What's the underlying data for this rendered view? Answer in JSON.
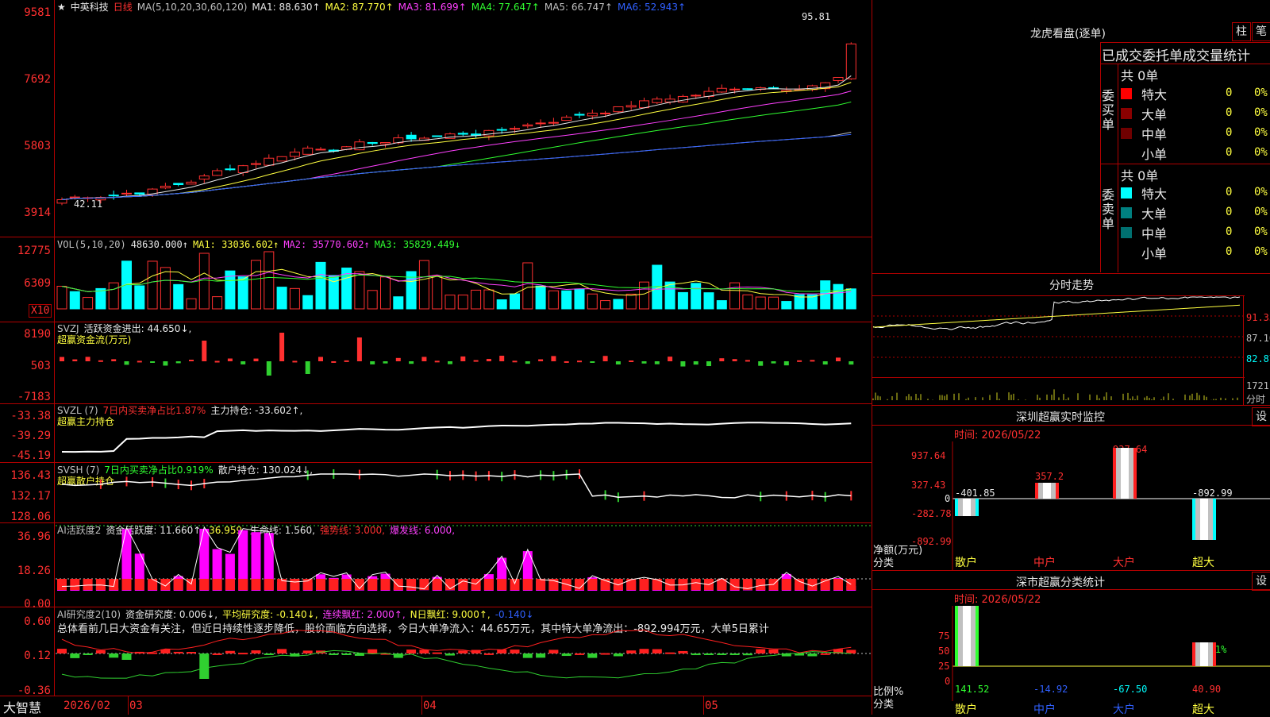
{
  "stock": {
    "name": "中英科技",
    "period": "日线",
    "star": "★"
  },
  "price_header": {
    "ma_label": "MA(5,10,20,30,60,120)",
    "ma1": "MA1: 88.630↑",
    "ma2": "MA2: 87.770↑",
    "ma3": "MA3: 81.699↑",
    "ma4": "MA4: 77.647↑",
    "ma5": "MA5: 66.747↑",
    "ma6": "MA6: 52.943↑",
    "high_label": "95.81",
    "low_label": "42.11"
  },
  "price_axis": [
    "9581",
    "7692",
    "5803",
    "3914"
  ],
  "vol_header": {
    "label": "VOL(5,10,20)",
    "value": "48630.000↑",
    "ma1": "MA1: 33036.602↑",
    "ma2": "MA2: 35770.602↑",
    "ma3": "MA3: 35829.449↓"
  },
  "vol_axis": [
    "12775",
    "6309"
  ],
  "vol_unit": "X10",
  "svzj_header": {
    "label": "SVZJ",
    "text": "活跃资金进出: 44.650↓,",
    "sub": "超赢资金流(万元)"
  },
  "svzj_axis": [
    "8190",
    "503",
    "-7183"
  ],
  "svzl_header": {
    "label": "SVZL (7)",
    "text1": "7日内买卖净占比1.87%",
    "text2": "主力持仓: -33.602↑,",
    "sub": "超赢主力持仓"
  },
  "svzl_axis": [
    "-33.38",
    "-39.29",
    "-45.19"
  ],
  "svsh_header": {
    "label": "SVSH (7)",
    "text1": "7日内买卖净占比0.919%",
    "text2": "散户持仓: 130.024↓,",
    "sub": "超赢散户持仓"
  },
  "svsh_axis": [
    "136.43",
    "132.17",
    "128.06"
  ],
  "ai_header": {
    "label": "AI活跃度2",
    "t1": "资金活跃度: 11.660↑,",
    "t2": "36.959,",
    "t3": "生命线: 1.560,",
    "t4": "强势线: 3.000,",
    "t5": "爆发线: 6.000,"
  },
  "ai_axis": [
    "36.96",
    "18.26",
    "0.00"
  ],
  "air_header": {
    "label": "AI研究度2(10)",
    "t1": "资金研究度: 0.006↓,",
    "t2": "平均研究度: -0.140↓,",
    "t3": "连续飘红: 2.000↑,",
    "t4": "N日飘红: 9.000↑,",
    "t5": "-0.140↓"
  },
  "air_text": "总体看前几日大资金有关注，但近日持续性逐步降低，股价面临方向选择，今日大单净流入：44.65万元，其中特大单净流出：-892.994万元，大单5日累计",
  "air_axis": [
    "0.60",
    "0.12",
    "-0.36"
  ],
  "time_axis": {
    "brand": "大智慧",
    "labels": [
      "2026/02",
      "03",
      "04",
      "05"
    ]
  },
  "right": {
    "lh_title": "龙虎看盘(逐单)",
    "btn_zhu": "柱",
    "btn_bi": "笔",
    "table_title": "已成交委托单成交量统计",
    "buy_label": "委买单",
    "sell_label": "委卖单",
    "buy_total": "共 0单",
    "sell_total": "共 0单",
    "buy_rows": [
      {
        "name": "特大",
        "v": "0",
        "p": "0%"
      },
      {
        "name": "大单",
        "v": "0",
        "p": "0%"
      },
      {
        "name": "中单",
        "v": "0",
        "p": "0%"
      },
      {
        "name": "小单",
        "v": "0",
        "p": "0%"
      }
    ],
    "sell_rows": [
      {
        "name": "特大",
        "v": "0",
        "p": "0%"
      },
      {
        "name": "大单",
        "v": "0",
        "p": "0%"
      },
      {
        "name": "中单",
        "v": "0",
        "p": "0%"
      },
      {
        "name": "小单",
        "v": "0",
        "p": "0%"
      }
    ],
    "fs_title": "分时走势",
    "fs_axis": [
      "91.33",
      "87.10",
      "82.87"
    ],
    "fs_vol": "1721",
    "fs_vol_unit": "分时",
    "sz_title": "深圳超赢实时监控",
    "sz_btn": "设",
    "sz_time": "时间: 2026/05/22",
    "sz_axis": [
      "937.64",
      "327.43",
      "0",
      "-282.78",
      "-892.99"
    ],
    "sz_values": {
      "sanhu": "-401.85",
      "zhonghu": "357.2",
      "dahu": "937.64",
      "chaoda": "-892.99"
    },
    "sz_unit": "净额(万元)",
    "sz_cat": "分类",
    "cats": [
      "散户",
      "中户",
      "大户",
      "超大"
    ],
    "ss_title": "深市超赢分类统计",
    "ss_btn": "设",
    "ss_time": "时间: 2026/05/22",
    "ss_axis": [
      "75",
      "50",
      "25",
      "0"
    ],
    "ss_top": "-0.21%",
    "ss_values": [
      "141.52",
      "-14.92",
      "-67.50",
      "40.90"
    ],
    "ss_unit": "比例%",
    "ss_cat": "分类"
  },
  "colors": {
    "up": "#ff3030",
    "down": "#00ffff",
    "grid": "#b00000",
    "ma1": "#e8e8e8",
    "ma2": "#ffff40",
    "ma3": "#ff40ff",
    "ma4": "#30ff30",
    "ma5": "#c0c0c0",
    "ma6": "#3060ff"
  }
}
